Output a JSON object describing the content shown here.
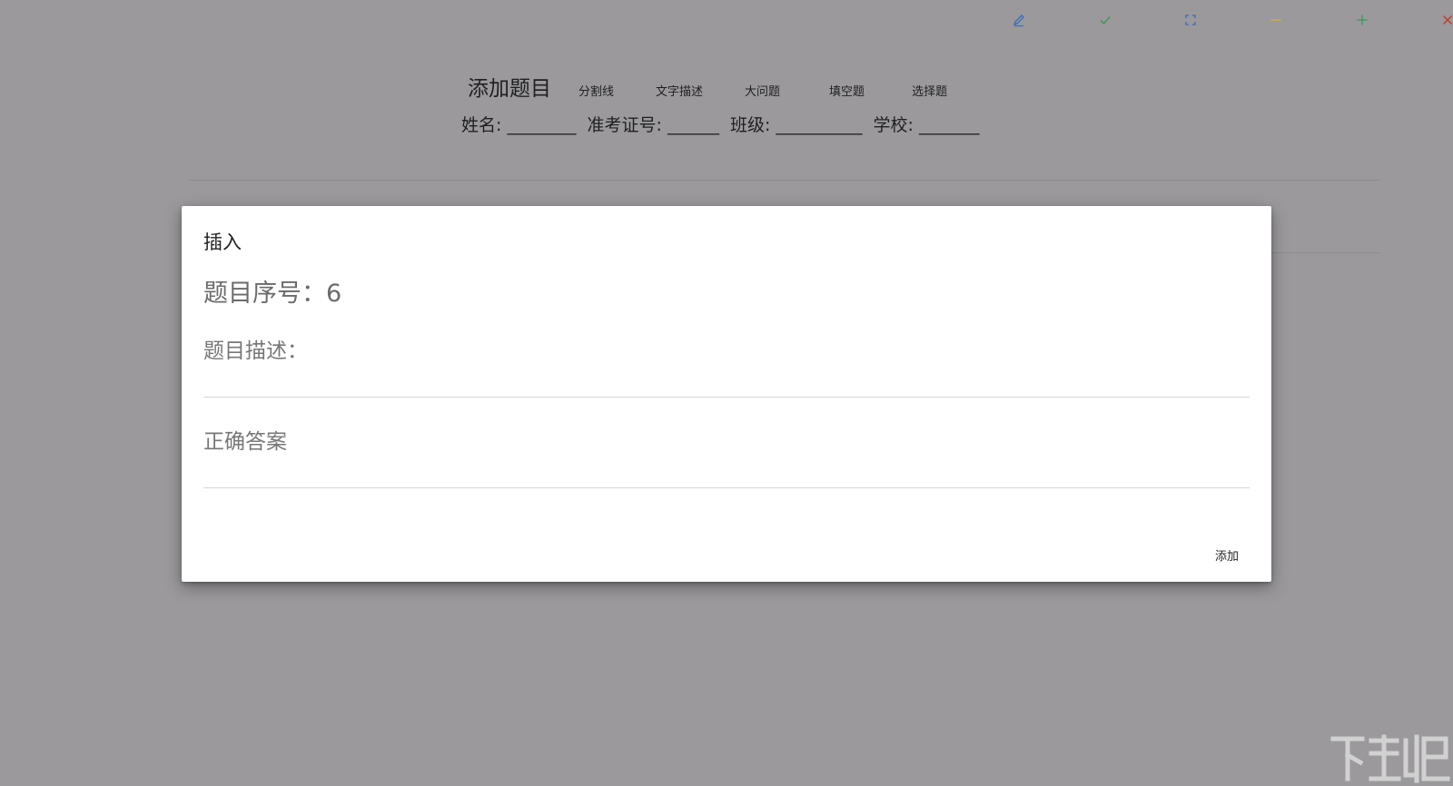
{
  "window_controls": {
    "edit_icon": "pen-icon",
    "check_icon": "check-icon",
    "fullscreen_icon": "fullscreen-icon",
    "minimize_icon": "minus-icon",
    "zoom_icon": "plus-icon",
    "close_icon": "close-icon",
    "colors": {
      "edit": "#3b6fb6",
      "check": "#3a9a5c",
      "fullscreen": "#3b6fb6",
      "minimize": "#d4b23a",
      "zoom": "#3a9a5c",
      "close": "#c0392b"
    }
  },
  "doc": {
    "title": "添加题目",
    "tools": {
      "divider": "分割线",
      "text_desc": "文字描述",
      "big_question": "大问题",
      "fill_blank": "填空题",
      "choice": "选择题"
    },
    "info": {
      "name": "姓名: ________",
      "exam_no": "准考证号: ______",
      "class": "班级: __________",
      "school": "学校: _______"
    }
  },
  "modal": {
    "title": "插入",
    "question_number": "题目序号：6",
    "desc_label": "题目描述：",
    "desc_value": "",
    "answer_label": "正确答案",
    "answer_value": "",
    "add_button": "添加"
  },
  "watermark": {
    "logo": "xiazaiba-watermark-logo"
  }
}
